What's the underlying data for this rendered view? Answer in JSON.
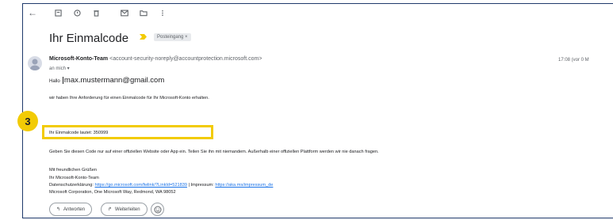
{
  "subject": "Ihr Einmalcode",
  "label_chip": "Posteingang ×",
  "sender": {
    "name": "Microsoft-Konto-Team",
    "address": "<account-security-noreply@accountprotection.microsoft.com>",
    "to": "an mich ▾",
    "time": "17:08 (vor 0 M"
  },
  "greeting": {
    "prefix": "Hallo",
    "email": "max.mustermann@gmail.com"
  },
  "body": {
    "line1": "wir haben Ihre Anforderung für einen Einmalcode für Ihr Microsoft-Konto erhalten.",
    "code_line": "Ihr Einmalcode lautet: 350999",
    "line3": "Geben Sie diesen Code nur auf einer offiziellen Website oder App ein. Teilen Sie ihn mit niemandem. Außerhalb einer offiziellen Plattform werden wir nie danach fragen.",
    "closing1": "Mit freundlichen Grüßen",
    "closing2": "Ihr Microsoft-Konto-Team",
    "privacy_label": "Datenschutzerklärung:",
    "privacy_link": "https://go.microsoft.com/fwlink/?LinkId=521839",
    "imprint_sep": " | Impressum:",
    "imprint_link": "https://aka.ms/impressum_de",
    "address": "Microsoft Corporation, One Microsoft Way, Redmond, WA 98052"
  },
  "annotation": {
    "step": "3"
  },
  "actions": {
    "reply": "Antworten",
    "forward": "Weiterleiten"
  },
  "icons": {
    "back": "arrow-left-icon",
    "archive": "archive-icon",
    "spam": "report-spam-icon",
    "delete": "trash-icon",
    "mark_unread": "mail-icon",
    "move": "folder-icon",
    "more": "more-vert-icon",
    "emoji": "emoji-icon"
  },
  "colors": {
    "highlight": "#f2cb05",
    "link": "#1a73e8",
    "frame": "#1f3a6b"
  }
}
